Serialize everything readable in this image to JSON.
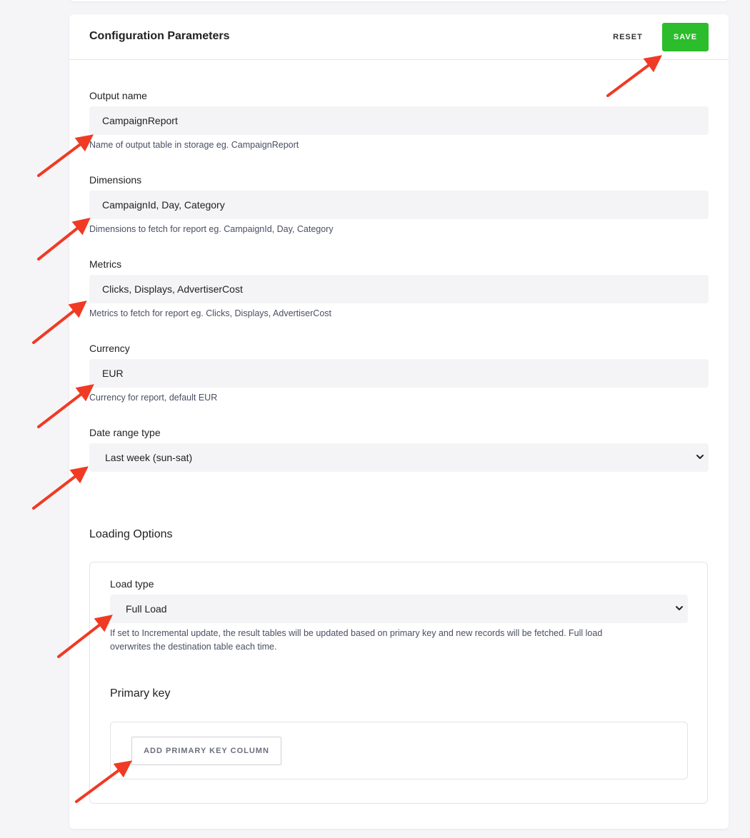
{
  "header": {
    "title": "Configuration Parameters",
    "reset_label": "RESET",
    "save_label": "SAVE"
  },
  "fields": {
    "output_name": {
      "label": "Output name",
      "value": "CampaignReport",
      "help": "Name of output table in storage eg. CampaignReport"
    },
    "dimensions": {
      "label": "Dimensions",
      "value": "CampaignId, Day, Category",
      "help": "Dimensions to fetch for report eg. CampaignId, Day, Category"
    },
    "metrics": {
      "label": "Metrics",
      "value": "Clicks, Displays, AdvertiserCost",
      "help": "Metrics to fetch for report eg. Clicks, Displays, AdvertiserCost"
    },
    "currency": {
      "label": "Currency",
      "value": "EUR",
      "help": "Currency for report, default EUR"
    },
    "date_range_type": {
      "label": "Date range type",
      "selected": "Last week (sun-sat)"
    }
  },
  "loading_options": {
    "title": "Loading Options",
    "load_type": {
      "label": "Load type",
      "selected": "Full Load",
      "help_line1": "If set to Incremental update, the result tables will be updated based on primary key and new records will be fetched. Full load",
      "help_line2": "overwrites the destination table each time."
    },
    "primary_key": {
      "title": "Primary key",
      "add_button_label": "ADD PRIMARY KEY COLUMN"
    }
  },
  "colors": {
    "save_button": "#2bbd2b",
    "annotation_arrow": "#f03a24",
    "input_background": "#f4f4f6"
  },
  "icons": {
    "select_chevron": "chevron-down-icon",
    "annotation": "red-arrow-annotation"
  }
}
